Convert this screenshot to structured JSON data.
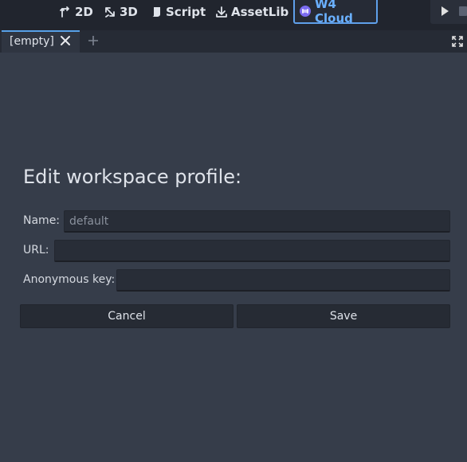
{
  "toolbar": {
    "modes": [
      {
        "label": "2D",
        "icon": "2d-transform-icon"
      },
      {
        "label": "3D",
        "icon": "3d-rotate-icon"
      },
      {
        "label": "Script",
        "icon": "script-icon"
      },
      {
        "label": "AssetLib",
        "icon": "download-icon"
      },
      {
        "label": "W4 Cloud",
        "icon": "w4-cloud-icon",
        "active": true
      }
    ],
    "accent_color": "#5fa0ea"
  },
  "tabs": {
    "items": [
      {
        "label": "[empty]",
        "active": true
      }
    ]
  },
  "form": {
    "heading": "Edit workspace profile:",
    "name_label": "Name:",
    "name_placeholder": "default",
    "url_label": "URL:",
    "url_value": "",
    "key_label": "Anonymous key:",
    "key_value": "",
    "cancel_label": "Cancel",
    "save_label": "Save"
  }
}
